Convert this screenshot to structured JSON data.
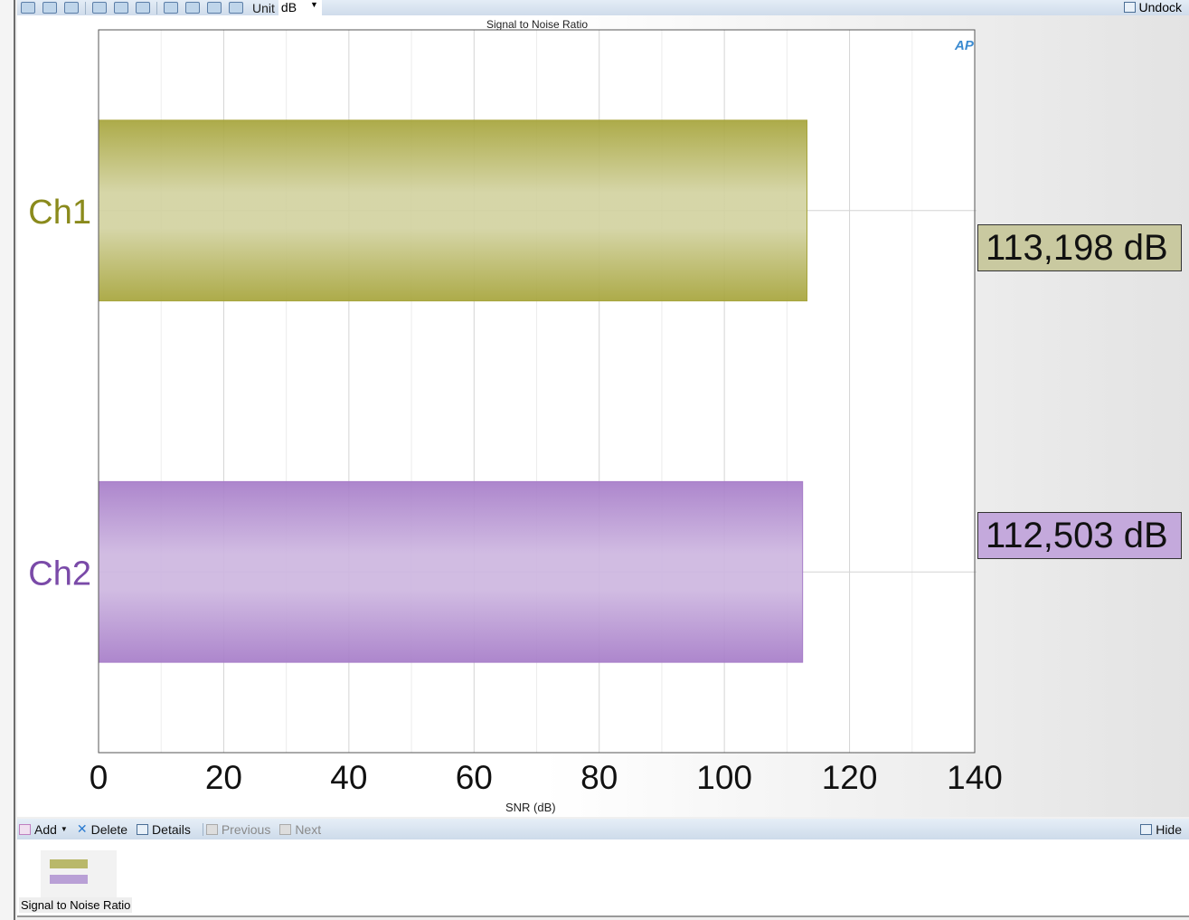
{
  "toolbar": {
    "unit_label": "Unit",
    "unit_value": "dB",
    "undock_label": "Undock",
    "icons": [
      "save-icon",
      "copy-icon",
      "print-icon",
      "zoom-icon",
      "fit-icon",
      "export-icon",
      "table-icon",
      "graph-icon",
      "fx-icon",
      "properties-icon"
    ]
  },
  "chart_data": {
    "type": "bar",
    "orientation": "horizontal",
    "title": "Signal to Noise Ratio",
    "categories": [
      "Ch1",
      "Ch2"
    ],
    "values": [
      113.198,
      112.503
    ],
    "value_labels": [
      "113,198 dB",
      "112,503 dB"
    ],
    "colors": [
      "#a6a43a",
      "#a67cc8"
    ],
    "label_colors": [
      "#8a8a1c",
      "#7a4aa8"
    ],
    "xlabel": "SNR (dB)",
    "xlim": [
      0,
      140
    ],
    "xticks": [
      "0",
      "20",
      "40",
      "60",
      "80",
      "100",
      "120",
      "140"
    ],
    "grid": true
  },
  "bottom": {
    "add": "Add",
    "delete": "Delete",
    "details": "Details",
    "previous": "Previous",
    "next": "Next",
    "hide": "Hide"
  },
  "thumbnails": [
    {
      "label": "Signal to Noise Ratio"
    }
  ]
}
